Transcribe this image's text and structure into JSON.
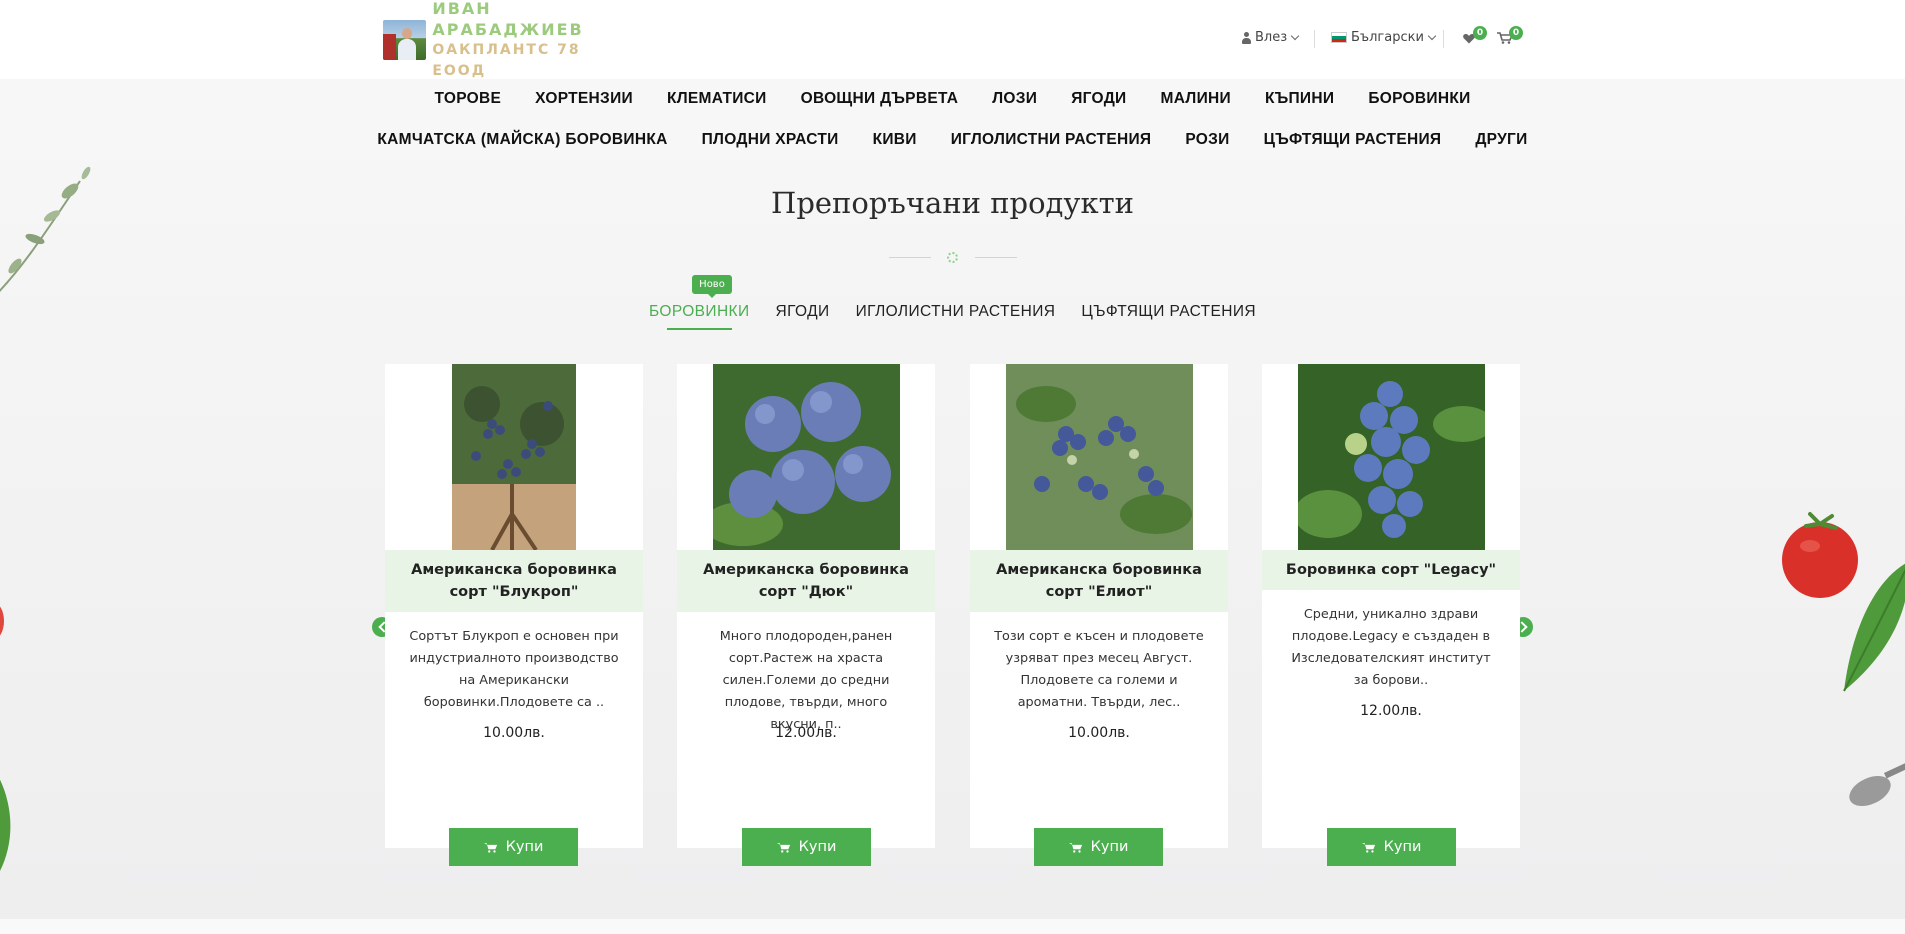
{
  "brand": {
    "line1": "ИВАН АРАБАДЖИЕВ",
    "line2": "ОАКПЛАНТС 78 ЕООД"
  },
  "header": {
    "login_label": "Влез",
    "language_label": "Български",
    "wishlist_count": "0",
    "cart_count": "0"
  },
  "nav": {
    "row1": [
      "ТОРОВЕ",
      "ХОРТЕНЗИИ",
      "КЛЕМАТИСИ",
      "ОВОЩНИ ДЪРВЕТА",
      "ЛОЗИ",
      "ЯГОДИ",
      "МАЛИНИ",
      "КЪПИНИ",
      "БОРОВИНКИ"
    ],
    "row2": [
      "КАМЧАТСКА (МАЙСКА) БОРОВИНКА",
      "ПЛОДНИ ХРАСТИ",
      "КИВИ",
      "ИГЛОЛИСТНИ РАСТЕНИЯ",
      "РОЗИ",
      "ЦЪФТЯЩИ РАСТЕНИЯ",
      "ДРУГИ"
    ]
  },
  "section": {
    "title": "Препоръчани продукти",
    "new_badge": "Ново"
  },
  "tabs": [
    {
      "label": "БОРОВИНКИ",
      "active": true
    },
    {
      "label": "ЯГОДИ",
      "active": false
    },
    {
      "label": "ИГЛОЛИСТНИ РАСТЕНИЯ",
      "active": false
    },
    {
      "label": "ЦЪФТЯЩИ РАСТЕНИЯ",
      "active": false
    }
  ],
  "products": [
    {
      "name": "Американска боровинка сорт \"Блукроп\"",
      "description": "Сортът Блукроп е основен при индустриалното производство на Американски боровинки.Плодовете са  ..",
      "price": "10.00лв.",
      "buy_label": "Купи"
    },
    {
      "name": "Американска боровинка сорт \"Дюк\"",
      "description": "Много плодороден,ранен сорт.Растеж на храста силен.Големи до средни плодове, твърди, много вкусни, п..",
      "price": "12.00лв.",
      "buy_label": "Купи"
    },
    {
      "name": "Американска боровинка сорт \"Елиот\"",
      "description": "Този сорт е късен и плодовете узряват през месец Август. Плодовете са големи и ароматни. Твърди, лес..",
      "price": "10.00лв.",
      "buy_label": "Купи"
    },
    {
      "name": "Боровинка сорт \"Legacy\"",
      "description": "Средни, уникално здрави плодове.Legacy е създаден в Изследователският институт  за борови..",
      "price": "12.00лв.",
      "buy_label": "Купи"
    }
  ],
  "colors": {
    "accent": "#4bae4f",
    "card_title_bg": "#e8f5e6",
    "nav_bg": "#f7f7f7"
  },
  "icons": {
    "login": "user-icon",
    "wishlist": "heart-icon",
    "cart": "cart-icon",
    "prev": "chevron-left-icon",
    "next": "chevron-right-icon",
    "divider": "flower-icon"
  }
}
